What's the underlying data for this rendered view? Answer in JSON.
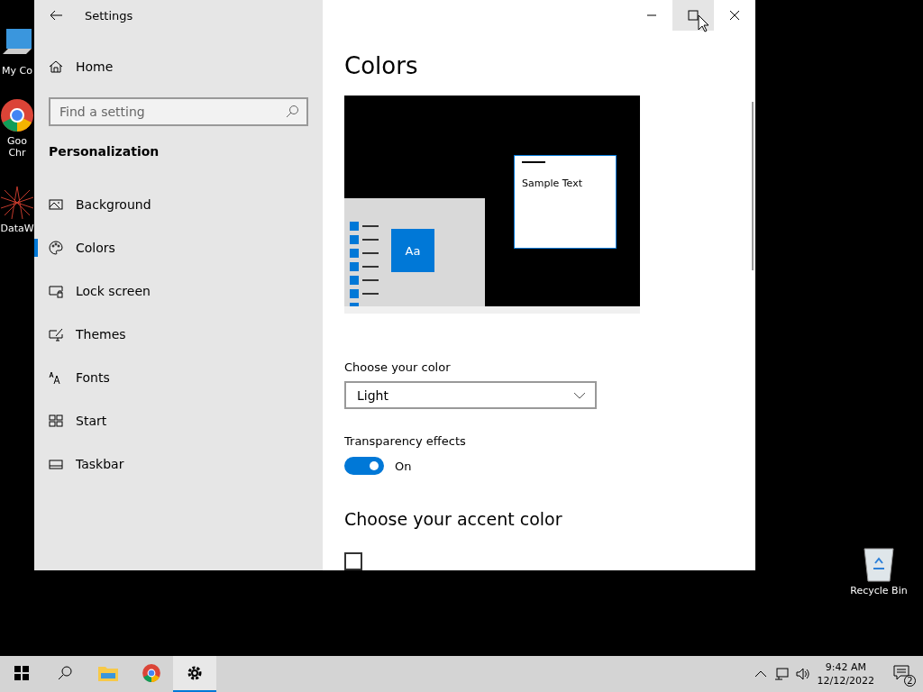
{
  "desktop_icons": [
    {
      "label_lines": [
        "My Co"
      ],
      "kind": "computer"
    },
    {
      "label_lines": [
        "Goo",
        "Chr"
      ],
      "kind": "browser"
    },
    {
      "label_lines": [
        "DataW"
      ],
      "kind": "app"
    },
    {
      "label_lines": [
        "Recycle Bin"
      ],
      "kind": "bin"
    }
  ],
  "window": {
    "title": "Settings",
    "controls": [
      {
        "kind": "minimize",
        "hovered": false
      },
      {
        "kind": "maximize",
        "hovered": true
      },
      {
        "kind": "close",
        "hovered": false
      }
    ]
  },
  "sidebar": {
    "home": "Home",
    "search": {
      "placeholder": "Find a setting"
    },
    "section": "Personalization",
    "items": [
      {
        "label": "Background",
        "kind": "background",
        "selected": false
      },
      {
        "label": "Colors",
        "kind": "colors",
        "selected": true
      },
      {
        "label": "Lock screen",
        "kind": "lock",
        "selected": false
      },
      {
        "label": "Themes",
        "kind": "themes",
        "selected": false
      },
      {
        "label": "Fonts",
        "kind": "fonts",
        "selected": false
      },
      {
        "label": "Start",
        "kind": "start",
        "selected": false
      },
      {
        "label": "Taskbar",
        "kind": "taskbar",
        "selected": false
      }
    ]
  },
  "content": {
    "title": "Colors",
    "preview": {
      "tile_text": "Aa",
      "sample_text": "Sample Text"
    },
    "color_label": "Choose your color",
    "color_value": "Light",
    "transparency": {
      "label": "Transparency effects",
      "on": true,
      "state_label": "On"
    },
    "accent_heading": "Choose your accent color",
    "auto_accent": {
      "checked": false
    }
  },
  "taskbar": {
    "apps": [
      {
        "kind": "start",
        "selected": false
      },
      {
        "kind": "search",
        "selected": false
      },
      {
        "kind": "explorer",
        "selected": false
      },
      {
        "kind": "chrome",
        "selected": false
      },
      {
        "kind": "settings",
        "selected": true
      }
    ],
    "time": "9:42 AM",
    "date": "12/12/2022",
    "notifications": "2"
  }
}
